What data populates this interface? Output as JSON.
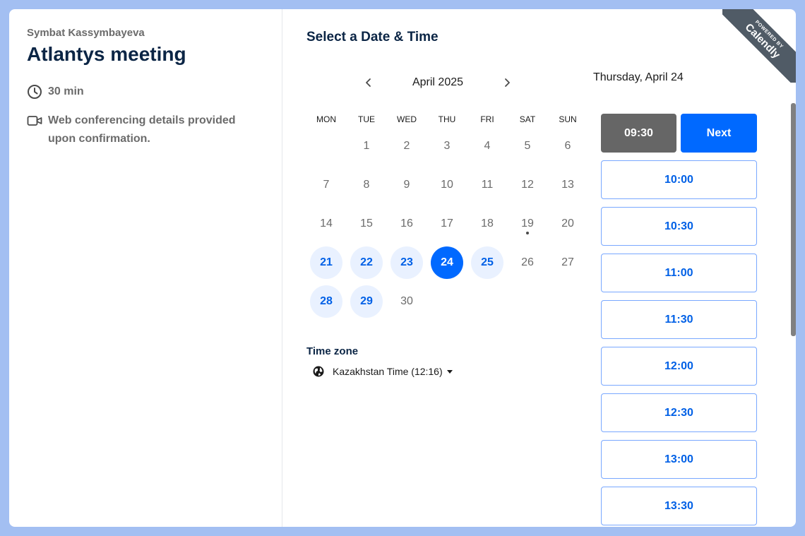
{
  "event": {
    "host": "Symbat Kassymbayeva",
    "title": "Atlantys meeting",
    "duration": "30 min",
    "location": "Web conferencing details provided upon confirmation."
  },
  "calendar": {
    "heading": "Select a Date & Time",
    "month": "April 2025",
    "weekdays": [
      "MON",
      "TUE",
      "WED",
      "THU",
      "FRI",
      "SAT",
      "SUN"
    ],
    "days": [
      "1",
      "2",
      "3",
      "4",
      "5",
      "6",
      "7",
      "8",
      "9",
      "10",
      "11",
      "12",
      "13",
      "14",
      "15",
      "16",
      "17",
      "18",
      "19",
      "20",
      "21",
      "22",
      "23",
      "24",
      "25",
      "26",
      "27",
      "28",
      "29",
      "30"
    ],
    "available_days": [
      "21",
      "22",
      "23",
      "25",
      "28",
      "29"
    ],
    "selected_day": "24",
    "today_dot_day": "19"
  },
  "timezone": {
    "label": "Time zone",
    "value": "Kazakhstan Time (12:16)"
  },
  "times": {
    "date_heading": "Thursday, April 24",
    "selected_slot": "09:30",
    "next_label": "Next",
    "slots": [
      "10:00",
      "10:30",
      "11:00",
      "11:30",
      "12:00",
      "12:30",
      "13:00",
      "13:30"
    ]
  },
  "branding": {
    "powered_by": "POWERED BY",
    "brand": "Calendly"
  },
  "colors": {
    "frame": "#a3bff2",
    "primary": "#0069ff",
    "available_bg": "#e9f1ff",
    "selected_slot_bg": "#666666",
    "heading_navy": "#0b2545"
  },
  "icons": {
    "duration": "clock-icon",
    "location": "video-camera-icon",
    "prev": "chevron-left-icon",
    "next": "chevron-right-icon",
    "timezone": "globe-icon",
    "dropdown": "caret-down-icon"
  }
}
